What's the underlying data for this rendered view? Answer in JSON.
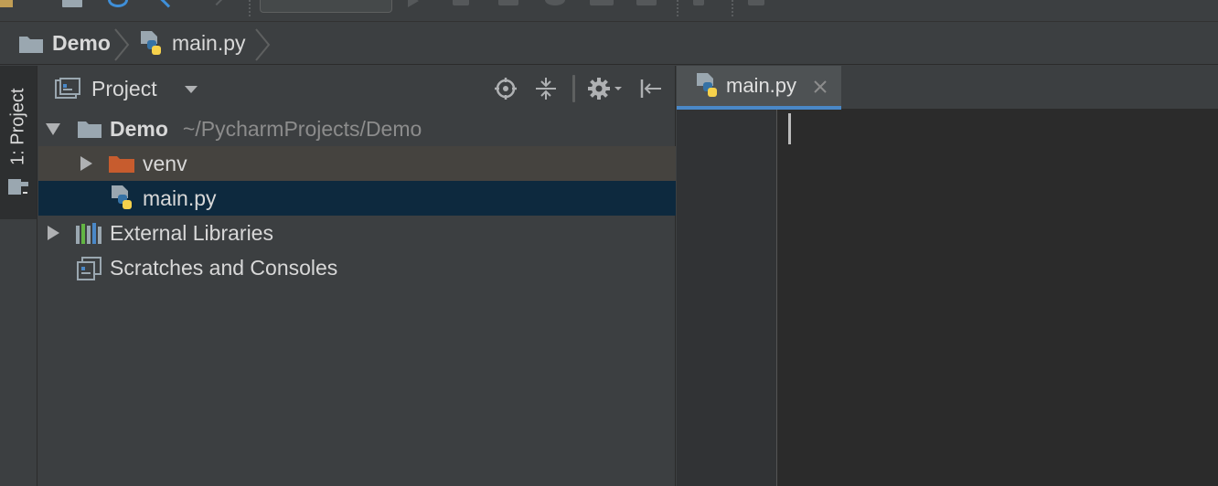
{
  "window": {
    "background": "#3c3f41"
  },
  "breadcrumb": {
    "items": [
      {
        "label": "Demo",
        "icon": "folder-icon"
      },
      {
        "label": "main.py",
        "icon": "python-file-icon"
      }
    ]
  },
  "tool_stripe": {
    "project_label": "1: Project"
  },
  "project_panel": {
    "title": "Project",
    "actions": [
      "locate-icon",
      "collapse-all-icon",
      "gear-icon",
      "hide-panel-icon"
    ],
    "tree": {
      "root": {
        "name": "Demo",
        "path": "~/PycharmProjects/Demo",
        "expanded": true
      },
      "venv": {
        "name": "venv",
        "expanded": false,
        "color": "#c75c2e"
      },
      "main": {
        "name": "main.py",
        "selected": true
      },
      "external_libraries": {
        "name": "External Libraries",
        "expanded": false
      },
      "scratches": {
        "name": "Scratches and Consoles"
      }
    }
  },
  "editor": {
    "tabs": [
      {
        "label": "main.py",
        "active": true
      }
    ],
    "accent": "#4a88c7"
  }
}
